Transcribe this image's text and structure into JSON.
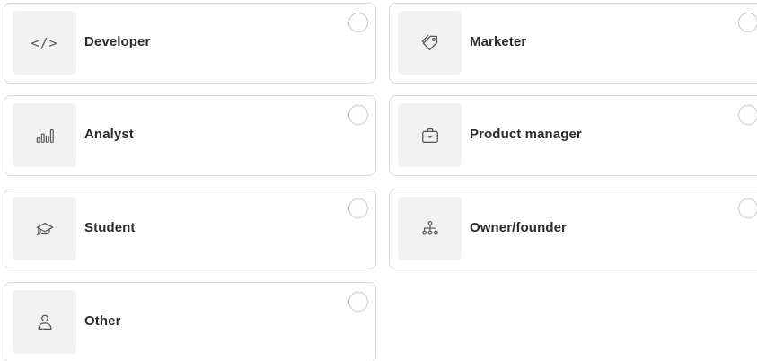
{
  "options": [
    {
      "id": "developer",
      "label": "Developer",
      "icon": "code-icon",
      "glyph": "</>",
      "selected": false
    },
    {
      "id": "marketer",
      "label": "Marketer",
      "icon": "tag-icon",
      "selected": false
    },
    {
      "id": "analyst",
      "label": "Analyst",
      "icon": "bar-chart-icon",
      "selected": false
    },
    {
      "id": "product-manager",
      "label": "Product manager",
      "icon": "briefcase-icon",
      "selected": false
    },
    {
      "id": "student",
      "label": "Student",
      "icon": "graduation-cap-icon",
      "selected": false
    },
    {
      "id": "owner-founder",
      "label": "Owner/founder",
      "icon": "org-chart-icon",
      "selected": false
    },
    {
      "id": "other",
      "label": "Other",
      "icon": "user-icon",
      "selected": false
    }
  ],
  "colors": {
    "card_border": "#d9d9d9",
    "icon_bg": "#f2f2f2",
    "label_text": "#2b2b2b",
    "icon_stroke": "#555555",
    "radio_border": "#c4c4c4"
  }
}
